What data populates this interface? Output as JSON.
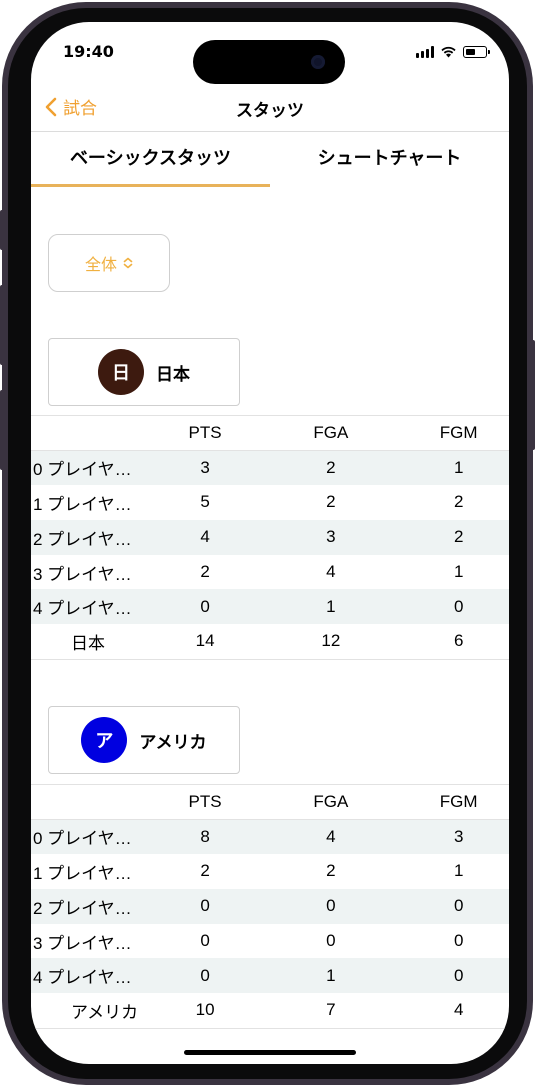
{
  "status_bar": {
    "time": "19:40"
  },
  "nav": {
    "back_label": "試合",
    "title": "スタッツ"
  },
  "tabs": [
    {
      "label": "ベーシックスタッツ",
      "selected": true
    },
    {
      "label": "シュートチャート",
      "selected": false
    }
  ],
  "filter": {
    "value": "全体"
  },
  "columns": [
    "PTS",
    "FGA",
    "FGM"
  ],
  "teams": [
    {
      "badge": "日",
      "badge_color": "#3d1a0f",
      "name": "日本",
      "players": [
        {
          "name": "0 プレイヤ…",
          "pts": "3",
          "fga": "2",
          "fgm": "1"
        },
        {
          "name": "1 プレイヤ…",
          "pts": "5",
          "fga": "2",
          "fgm": "2"
        },
        {
          "name": "2 プレイヤ…",
          "pts": "4",
          "fga": "3",
          "fgm": "2"
        },
        {
          "name": "3 プレイヤ…",
          "pts": "2",
          "fga": "4",
          "fgm": "1"
        },
        {
          "name": "4 プレイヤ…",
          "pts": "0",
          "fga": "1",
          "fgm": "0"
        }
      ],
      "total": {
        "name": "日本",
        "pts": "14",
        "fga": "12",
        "fgm": "6"
      }
    },
    {
      "badge": "ア",
      "badge_color": "#0000e0",
      "name": "アメリカ",
      "players": [
        {
          "name": "0 プレイヤ…",
          "pts": "8",
          "fga": "4",
          "fgm": "3"
        },
        {
          "name": "1 プレイヤ…",
          "pts": "2",
          "fga": "2",
          "fgm": "1"
        },
        {
          "name": "2 プレイヤ…",
          "pts": "0",
          "fga": "0",
          "fgm": "0"
        },
        {
          "name": "3 プレイヤ…",
          "pts": "0",
          "fga": "0",
          "fgm": "0"
        },
        {
          "name": "4 プレイヤ…",
          "pts": "0",
          "fga": "1",
          "fgm": "0"
        }
      ],
      "total": {
        "name": "アメリカ",
        "pts": "10",
        "fga": "7",
        "fgm": "4"
      }
    }
  ],
  "accent_color": "#f0a030"
}
